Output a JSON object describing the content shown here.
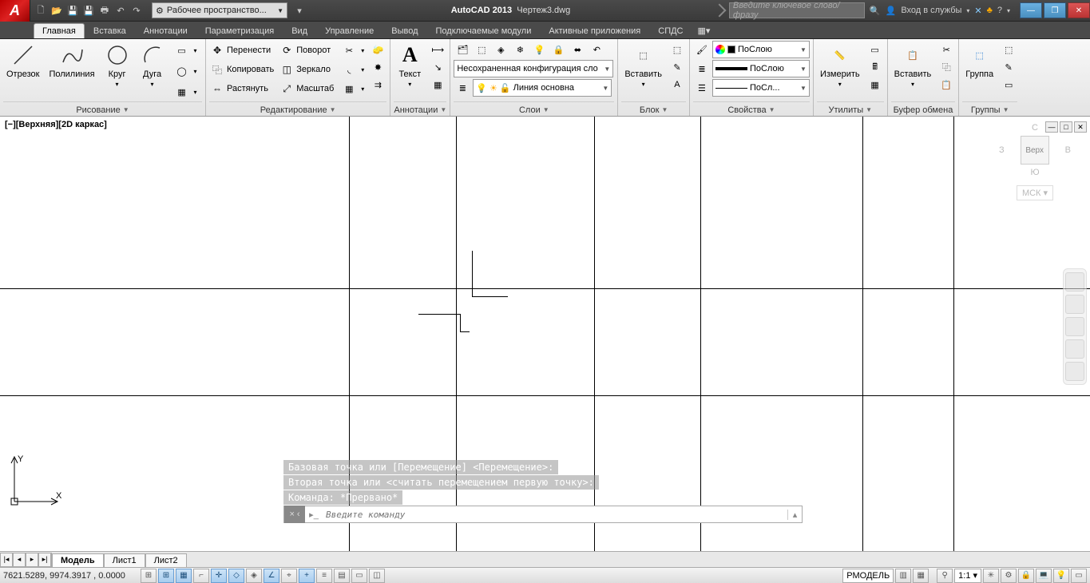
{
  "title": {
    "app": "AutoCAD 2013",
    "file": "Чертеж3.dwg"
  },
  "workspace_label": "Рабочее пространство...",
  "search_placeholder": "Введите ключевое слово/фразу",
  "signin": "Вход в службы",
  "tabs": [
    "Главная",
    "Вставка",
    "Аннотации",
    "Параметризация",
    "Вид",
    "Управление",
    "Вывод",
    "Подключаемые модули",
    "Активные приложения",
    "СПДС"
  ],
  "active_tab": 0,
  "ribbon": {
    "draw": {
      "title": "Рисование",
      "line": "Отрезок",
      "pline": "Полилиния",
      "circle": "Круг",
      "arc": "Дуга"
    },
    "modify": {
      "title": "Редактирование",
      "move": "Перенести",
      "copy": "Копировать",
      "stretch": "Растянуть",
      "rotate": "Поворот",
      "mirror": "Зеркало",
      "scale": "Масштаб"
    },
    "annotation": {
      "title": "Аннотации",
      "text": "Текст"
    },
    "layers": {
      "title": "Слои",
      "config": "Несохраненная конфигурация сло",
      "linetype": "Линия основна"
    },
    "block": {
      "title": "Блок",
      "insert": "Вставить"
    },
    "props": {
      "title": "Свойства",
      "bylayer": "ПоСлою",
      "bylayer2": "ПоСлою",
      "bylayer3": "ПоСл..."
    },
    "utils": {
      "title": "Утилиты",
      "measure": "Измерить"
    },
    "clip": {
      "title": "Буфер обмена",
      "paste": "Вставить"
    },
    "groups": {
      "title": "Группы",
      "group": "Группа"
    }
  },
  "viewport_label": "[−][Верхняя][2D каркас]",
  "viewcube": {
    "n": "С",
    "s": "Ю",
    "e": "В",
    "w": "З",
    "top": "Верх",
    "wcs": "МСК"
  },
  "cmd_history": [
    "Базовая точка или [Перемещение] <Перемещение>:",
    "Вторая точка или <считать перемещением первую точку>:",
    "Команда: *Прервано*"
  ],
  "cmd_placeholder": "Введите команду",
  "layout_tabs": [
    "Модель",
    "Лист1",
    "Лист2"
  ],
  "active_layout": 0,
  "coords": "7621.5289, 9974.3917 , 0.0000",
  "status": {
    "model": "РМОДЕЛЬ",
    "scale": "1:1"
  }
}
